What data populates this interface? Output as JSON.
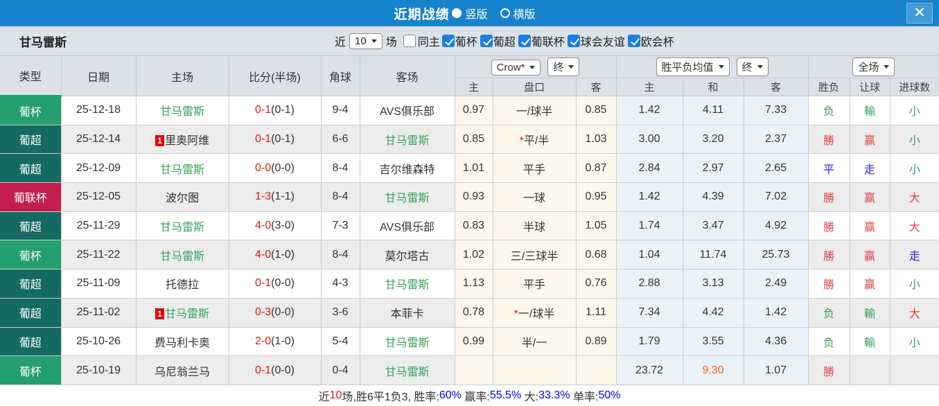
{
  "topbar": {
    "title": "近期战绩",
    "vertical_label": "竖版",
    "vertical_selected": true,
    "horizontal_label": "横版",
    "horizontal_selected": false,
    "close_icon": "✕"
  },
  "filterbar": {
    "team": "甘马雷斯",
    "recent_label": "近",
    "recent_value": "10",
    "games_label": "场",
    "same_home_label": "同主",
    "same_home_checked": false,
    "leagues": [
      {
        "label": "葡杯",
        "checked": true
      },
      {
        "label": "葡超",
        "checked": true
      },
      {
        "label": "葡联杯",
        "checked": true
      },
      {
        "label": "球会友谊",
        "checked": true
      },
      {
        "label": "欧会杯",
        "checked": true
      }
    ]
  },
  "table": {
    "selects": {
      "bookmaker": "Crow*",
      "stage1": "终",
      "avg": "胜平负均值",
      "stage2": "终",
      "scope": "全场"
    },
    "columns": {
      "type": "类型",
      "date": "日期",
      "home": "主场",
      "score": "比分(半场)",
      "corners": "角球",
      "away": "客场",
      "ah_home": "主",
      "ah_line": "盘口",
      "ah_away": "客",
      "eu_home": "主",
      "eu_draw": "和",
      "eu_away": "客",
      "outcome": "胜负",
      "handicap": "让球",
      "goals": "进球数"
    },
    "rows": [
      {
        "type": "葡杯",
        "type_class": "t-cup",
        "date": "25-12-18",
        "home": {
          "name": "甘马雷斯",
          "green": true,
          "badge": ""
        },
        "score": "0-1",
        "half": "(0-1)",
        "corners": "9-4",
        "away": {
          "name": "AVS俱乐部",
          "green": false,
          "badge": ""
        },
        "ah": {
          "home": "0.97",
          "star": "",
          "line": "一/球半",
          "away": "0.85"
        },
        "eu": {
          "home": "1.42",
          "draw": "4.11",
          "away": "7.33",
          "draw_hot": false
        },
        "res": {
          "outcome": "负",
          "outcome_class": "c-green",
          "handicap": "輸",
          "handicap_class": "c-green",
          "goals": "小",
          "goals_class": "c-green"
        }
      },
      {
        "type": "葡超",
        "type_class": "t-league",
        "date": "25-12-14",
        "home": {
          "name": "里奥阿维",
          "green": false,
          "badge": "1"
        },
        "score": "0-1",
        "half": "(0-1)",
        "corners": "6-6",
        "away": {
          "name": "甘马雷斯",
          "green": true,
          "badge": ""
        },
        "ah": {
          "home": "0.85",
          "star": "*",
          "line": "平/半",
          "away": "1.03"
        },
        "eu": {
          "home": "3.00",
          "draw": "3.20",
          "away": "2.37",
          "draw_hot": false
        },
        "res": {
          "outcome": "勝",
          "outcome_class": "c-red",
          "handicap": "赢",
          "handicap_class": "c-red",
          "goals": "小",
          "goals_class": "c-green"
        }
      },
      {
        "type": "葡超",
        "type_class": "t-league",
        "date": "25-12-09",
        "home": {
          "name": "甘马雷斯",
          "green": true,
          "badge": ""
        },
        "score": "0-0",
        "half": "(0-0)",
        "corners": "8-4",
        "away": {
          "name": "吉尔维森特",
          "green": false,
          "badge": ""
        },
        "ah": {
          "home": "1.01",
          "star": "",
          "line": "平手",
          "away": "0.87"
        },
        "eu": {
          "home": "2.84",
          "draw": "2.97",
          "away": "2.65",
          "draw_hot": false
        },
        "res": {
          "outcome": "平",
          "outcome_class": "c-blue",
          "handicap": "走",
          "handicap_class": "c-blue",
          "goals": "小",
          "goals_class": "c-green"
        }
      },
      {
        "type": "葡联杯",
        "type_class": "t-lcup",
        "date": "25-12-05",
        "home": {
          "name": "波尔图",
          "green": false,
          "badge": ""
        },
        "score": "1-3",
        "half": "(1-1)",
        "corners": "8-4",
        "away": {
          "name": "甘马雷斯",
          "green": true,
          "badge": ""
        },
        "ah": {
          "home": "0.93",
          "star": "",
          "line": "一球",
          "away": "0.95"
        },
        "eu": {
          "home": "1.42",
          "draw": "4.39",
          "away": "7.02",
          "draw_hot": false
        },
        "res": {
          "outcome": "勝",
          "outcome_class": "c-red",
          "handicap": "赢",
          "handicap_class": "c-red",
          "goals": "大",
          "goals_class": "c-red"
        }
      },
      {
        "type": "葡超",
        "type_class": "t-league",
        "date": "25-11-29",
        "home": {
          "name": "甘马雷斯",
          "green": true,
          "badge": ""
        },
        "score": "4-0",
        "half": "(3-0)",
        "corners": "7-3",
        "away": {
          "name": "AVS俱乐部",
          "green": false,
          "badge": ""
        },
        "ah": {
          "home": "0.83",
          "star": "",
          "line": "半球",
          "away": "1.05"
        },
        "eu": {
          "home": "1.74",
          "draw": "3.47",
          "away": "4.92",
          "draw_hot": false
        },
        "res": {
          "outcome": "勝",
          "outcome_class": "c-red",
          "handicap": "赢",
          "handicap_class": "c-red",
          "goals": "大",
          "goals_class": "c-red"
        }
      },
      {
        "type": "葡杯",
        "type_class": "t-cup",
        "date": "25-11-22",
        "home": {
          "name": "甘马雷斯",
          "green": true,
          "badge": ""
        },
        "score": "4-0",
        "half": "(1-0)",
        "corners": "8-4",
        "away": {
          "name": "莫尔塔古",
          "green": false,
          "badge": ""
        },
        "ah": {
          "home": "1.02",
          "star": "",
          "line": "三/三球半",
          "away": "0.68"
        },
        "eu": {
          "home": "1.04",
          "draw": "11.74",
          "away": "25.73",
          "draw_hot": false
        },
        "res": {
          "outcome": "勝",
          "outcome_class": "c-red",
          "handicap": "赢",
          "handicap_class": "c-red",
          "goals": "走",
          "goals_class": "c-blue"
        }
      },
      {
        "type": "葡超",
        "type_class": "t-league",
        "date": "25-11-09",
        "home": {
          "name": "托德拉",
          "green": false,
          "badge": ""
        },
        "score": "0-1",
        "half": "(0-0)",
        "corners": "4-3",
        "away": {
          "name": "甘马雷斯",
          "green": true,
          "badge": ""
        },
        "ah": {
          "home": "1.13",
          "star": "",
          "line": "平手",
          "away": "0.76"
        },
        "eu": {
          "home": "2.88",
          "draw": "3.13",
          "away": "2.49",
          "draw_hot": false
        },
        "res": {
          "outcome": "勝",
          "outcome_class": "c-red",
          "handicap": "赢",
          "handicap_class": "c-red",
          "goals": "小",
          "goals_class": "c-green"
        }
      },
      {
        "type": "葡超",
        "type_class": "t-league",
        "date": "25-11-02",
        "home": {
          "name": "甘马雷斯",
          "green": true,
          "badge": "1"
        },
        "score": "0-3",
        "half": "(0-0)",
        "corners": "3-6",
        "away": {
          "name": "本菲卡",
          "green": false,
          "badge": ""
        },
        "ah": {
          "home": "0.78",
          "star": "*",
          "line": "一/球半",
          "away": "1.11"
        },
        "eu": {
          "home": "7.34",
          "draw": "4.42",
          "away": "1.42",
          "draw_hot": false
        },
        "res": {
          "outcome": "负",
          "outcome_class": "c-green",
          "handicap": "輸",
          "handicap_class": "c-green",
          "goals": "大",
          "goals_class": "c-red"
        }
      },
      {
        "type": "葡超",
        "type_class": "t-league",
        "date": "25-10-26",
        "home": {
          "name": "费马利卡奥",
          "green": false,
          "badge": ""
        },
        "score": "2-0",
        "half": "(1-0)",
        "corners": "5-4",
        "away": {
          "name": "甘马雷斯",
          "green": true,
          "badge": ""
        },
        "ah": {
          "home": "0.99",
          "star": "",
          "line": "半/一",
          "away": "0.89"
        },
        "eu": {
          "home": "1.79",
          "draw": "3.55",
          "away": "4.36",
          "draw_hot": false
        },
        "res": {
          "outcome": "负",
          "outcome_class": "c-green",
          "handicap": "輸",
          "handicap_class": "c-green",
          "goals": "小",
          "goals_class": "c-green"
        }
      },
      {
        "type": "葡杯",
        "type_class": "t-cup",
        "date": "25-10-19",
        "home": {
          "name": "乌尼翁兰马",
          "green": false,
          "badge": ""
        },
        "score": "0-1",
        "half": "(0-0)",
        "corners": "0-4",
        "away": {
          "name": "甘马雷斯",
          "green": true,
          "badge": ""
        },
        "ah": {
          "home": "",
          "star": "",
          "line": "",
          "away": ""
        },
        "eu": {
          "home": "23.72",
          "draw": "9.30",
          "away": "1.07",
          "draw_hot": true
        },
        "res": {
          "outcome": "勝",
          "outcome_class": "c-red",
          "handicap": "",
          "handicap_class": "",
          "goals": "",
          "goals_class": ""
        }
      }
    ]
  },
  "summary": {
    "prefix": "近",
    "count": "10",
    "segment": "场,胜6平1负3, 胜率:",
    "win_rate": "60%",
    "label_win": " 赢率:",
    "rate_win": "55.5%",
    "label_big": " 大:",
    "rate_big": "33.3%",
    "label_single": " 单率:",
    "rate_single": "50%"
  },
  "colors": {
    "topbar_blue": "#1682cb",
    "cup_green": "#23a06e",
    "league_teal": "#156b61",
    "league_cup_crimson": "#c41d50",
    "highlight_team_green": "#3aa35c",
    "score_red": "#e8150c",
    "result_red": "#e04444",
    "result_green": "#36a05e",
    "result_blue": "#2626e0",
    "hot_orange": "#ff6600",
    "summary_blue": "#0000ee"
  }
}
